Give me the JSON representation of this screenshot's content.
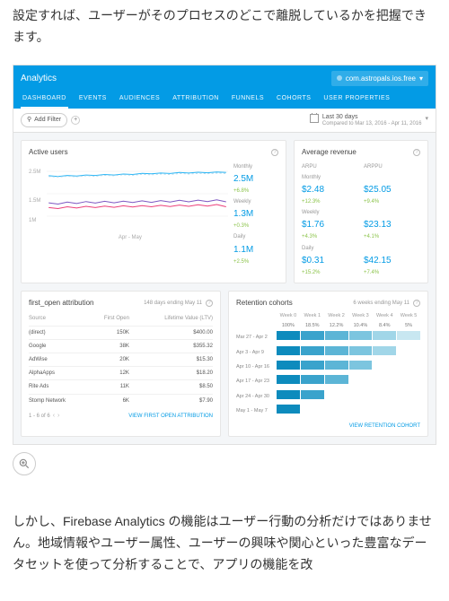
{
  "para_top": "設定すれば、ユーザーがそのプロセスのどこで離脱しているかを把握できます。",
  "para_bottom": "しかし、Firebase Analytics の機能はユーザー行動の分析だけではありません。地域情報やユーザー属性、ユーザーの興味や関心といった豊富なデータセットを使って分析することで、アプリの機能を改",
  "header": {
    "title": "Analytics",
    "project": "com.astropals.ios.free",
    "tabs": [
      "DASHBOARD",
      "EVENTS",
      "AUDIENCES",
      "ATTRIBUTION",
      "FUNNELS",
      "COHORTS",
      "USER PROPERTIES"
    ]
  },
  "filter": {
    "add": "Add Filter",
    "period": "Last 30 days",
    "compare": "Compared to Mar 13, 2016 - Apr 11, 2016"
  },
  "active_users": {
    "title": "Active users",
    "yticks": [
      "2.5M",
      "1.5M",
      "1M"
    ],
    "xlabel": "Apr - May",
    "legend": [
      "Monthly",
      "Weekly",
      "Daily"
    ],
    "metrics": [
      {
        "lbl": "Monthly",
        "val": "2.5M",
        "pct": "+6.8%"
      },
      {
        "lbl": "Weekly",
        "val": "1.3M",
        "pct": "+0.3%"
      },
      {
        "lbl": "Daily",
        "val": "1.1M",
        "pct": "+2.5%"
      }
    ]
  },
  "revenue": {
    "title": "Average revenue",
    "heads": [
      "ARPU",
      "ARPPU"
    ],
    "rows": [
      {
        "lbl": "Monthly",
        "a": "$2.48",
        "ap": "+12.3%",
        "b": "$25.05",
        "bp": "+9.4%"
      },
      {
        "lbl": "Weekly",
        "a": "$1.76",
        "ap": "+4.3%",
        "b": "$23.13",
        "bp": "+4.1%"
      },
      {
        "lbl": "Daily",
        "a": "$0.31",
        "ap": "+15.2%",
        "b": "$42.15",
        "bp": "+7.4%"
      }
    ]
  },
  "attribution": {
    "title": "first_open attribution",
    "sub": "148 days ending May 11",
    "cols": [
      "Source",
      "First Open",
      "Lifetime Value (LTV)"
    ],
    "rows": [
      [
        "(direct)",
        "150K",
        "$400.00"
      ],
      [
        "Google",
        "38K",
        "$355.32"
      ],
      [
        "AdWise",
        "20K",
        "$15.30"
      ],
      [
        "AlphaApps",
        "12K",
        "$18.20"
      ],
      [
        "Rite Ads",
        "11K",
        "$8.50"
      ],
      [
        "Stomp Network",
        "6K",
        "$7.90"
      ]
    ],
    "pager": "1 - 6 of 6",
    "link": "VIEW FIRST OPEN ATTRIBUTION"
  },
  "cohort": {
    "title": "Retention cohorts",
    "sub": "6 weeks ending May 11",
    "weeks": [
      "Week 0",
      "Week 1",
      "Week 2",
      "Week 3",
      "Week 4",
      "Week 5"
    ],
    "pcts": [
      "100%",
      "18.5%",
      "12.2%",
      "10.4%",
      "8.4%",
      "5%"
    ],
    "row_labels": [
      "Mar 27 - Apr 2",
      "Apr 3 - Apr 9",
      "Apr 10 - Apr 16",
      "Apr 17 - Apr 23",
      "Apr 24 - Apr 30",
      "May 1 - May 7"
    ],
    "link": "VIEW RETENTION COHORT"
  },
  "chart_data": {
    "type": "line",
    "title": "Active users",
    "xlabel": "Apr - May",
    "ylim": [
      0,
      2600000
    ],
    "yticks": [
      1000000,
      1500000,
      2500000
    ],
    "series": [
      {
        "name": "Monthly",
        "values": [
          2350000,
          2320000,
          2360000,
          2340000,
          2380000,
          2360000,
          2400000,
          2380000,
          2420000,
          2400000,
          2450000,
          2430000,
          2460000,
          2440000,
          2480000,
          2460000,
          2490000,
          2470000,
          2500000,
          2480000
        ],
        "color": "#29b6f6",
        "dashed": false
      },
      {
        "name": "Monthly (prev)",
        "values": [
          2320000,
          2300000,
          2330000,
          2310000,
          2350000,
          2330000,
          2370000,
          2350000,
          2390000,
          2370000,
          2410000,
          2390000,
          2420000,
          2400000,
          2440000,
          2420000,
          2450000,
          2430000,
          2460000,
          2440000
        ],
        "color": "#b3d9ec",
        "dashed": true
      },
      {
        "name": "Weekly",
        "values": [
          1260000,
          1210000,
          1290000,
          1230000,
          1310000,
          1250000,
          1320000,
          1260000,
          1330000,
          1270000,
          1340000,
          1280000,
          1350000,
          1290000,
          1360000,
          1300000,
          1370000,
          1310000,
          1380000,
          1300000
        ],
        "color": "#7e57c2",
        "dashed": false
      },
      {
        "name": "Daily",
        "values": [
          1070000,
          1030000,
          1100000,
          1050000,
          1120000,
          1070000,
          1130000,
          1080000,
          1140000,
          1090000,
          1150000,
          1100000,
          1160000,
          1110000,
          1170000,
          1120000,
          1180000,
          1130000,
          1190000,
          1100000
        ],
        "color": "#ec407a",
        "dashed": false
      }
    ]
  }
}
